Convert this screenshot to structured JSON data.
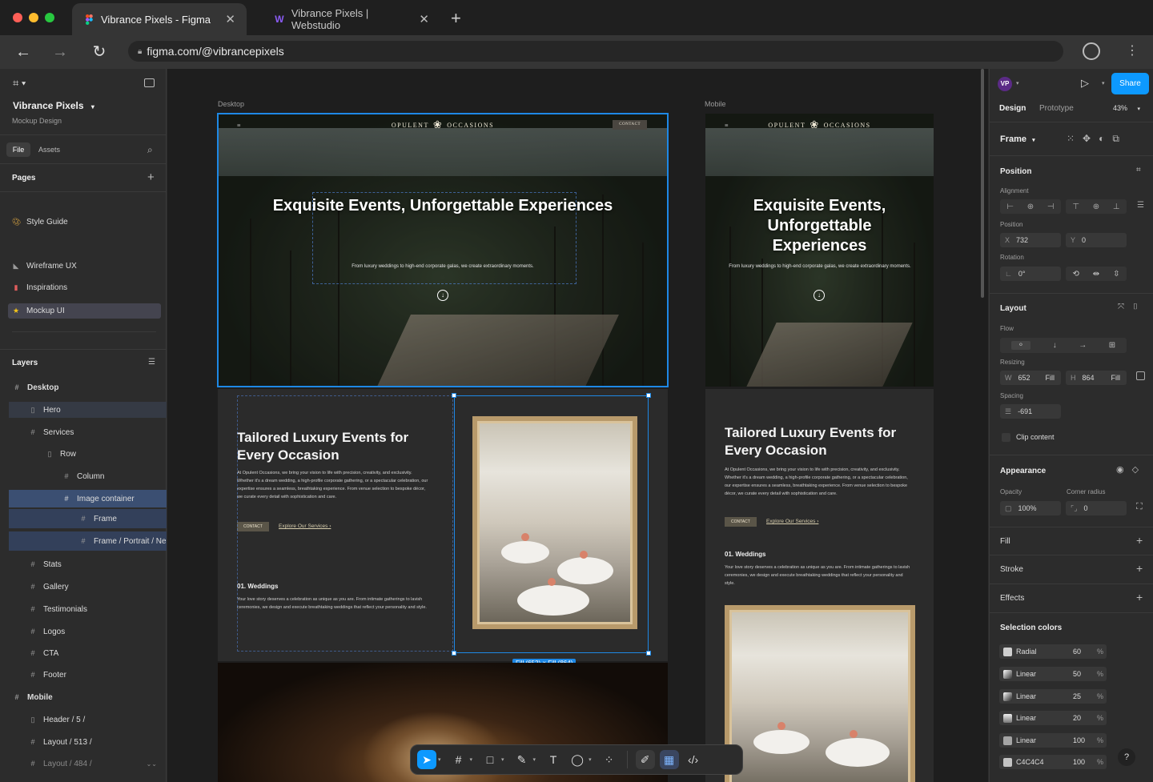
{
  "browser": {
    "tabs": [
      {
        "title": "Vibrance Pixels - Figma",
        "favicon": "figma-icon"
      },
      {
        "title": "Vibrance Pixels | Webstudio",
        "favicon": "webstudio-icon"
      }
    ],
    "url": "figma.com/@vibrancepixels"
  },
  "left_panel": {
    "team": "Vibrance Pixels",
    "project": "Mockup Design",
    "tabs": [
      "File",
      "Assets"
    ],
    "pages_title": "Pages",
    "pages": [
      "Style Guide",
      "Wireframe UX",
      "Inspirations",
      "Mockup UI"
    ],
    "layers_title": "Layers",
    "layers": [
      {
        "name": "Desktop",
        "icon": "frame-icon"
      },
      {
        "name": "Hero",
        "icon": "layout-icon"
      },
      {
        "name": "Services",
        "icon": "frame-icon"
      },
      {
        "name": "Row",
        "icon": "layout-icon"
      },
      {
        "name": "Column",
        "icon": "frame-icon"
      },
      {
        "name": "Image container",
        "icon": "grid-icon"
      },
      {
        "name": "Frame",
        "icon": "grid-icon"
      },
      {
        "name": "Frame / Portrait / Ne",
        "icon": "grid-icon"
      },
      {
        "name": "Stats",
        "icon": "frame-icon"
      },
      {
        "name": "Gallery",
        "icon": "frame-icon"
      },
      {
        "name": "Testimonials",
        "icon": "frame-icon"
      },
      {
        "name": "Logos",
        "icon": "frame-icon"
      },
      {
        "name": "CTA",
        "icon": "frame-icon"
      },
      {
        "name": "Footer",
        "icon": "frame-icon"
      },
      {
        "name": "Mobile",
        "icon": "frame-icon"
      },
      {
        "name": "Header / 5 /",
        "icon": "layout-icon"
      },
      {
        "name": "Layout / 513 /",
        "icon": "frame-icon"
      },
      {
        "name": "Layout / 484 /",
        "icon": "frame-icon"
      }
    ]
  },
  "canvas": {
    "desktop_label": "Desktop",
    "mobile_label": "Mobile",
    "brand_left": "OPULENT",
    "brand_right": "OCCASIONS",
    "contact": "CONTACT",
    "hero_title": "Exquisite Events, Unforgettable Experiences",
    "hero_sub": "From luxury weddings to high-end corporate galas, we create extraordinary moments.",
    "services_title": "Tailored Luxury Events for Every Occasion",
    "services_body": "At Opulent Occasions, we bring your vision to life with precision, creativity, and exclusivity. Whether it's a dream wedding, a high-profile corporate gathering, or a spectacular celebration, our expertise ensures a seamless, breathtaking experience. From venue selection to bespoke décor, we curate every detail with sophistication and care.",
    "explore": "Explore Our Services",
    "weddings_title": "01. Weddings",
    "weddings_body": "Your love story deserves a celebration as unique as you are. From intimate gatherings to lavish ceremonies, we design and execute breathtaking weddings that reflect your personality and style.",
    "size_badge": "Fill (652) × Fill (864)"
  },
  "right_panel": {
    "avatar": "VP",
    "share": "Share",
    "tabs": [
      "Design",
      "Prototype"
    ],
    "zoom": "43%",
    "frame_label": "Frame",
    "position_title": "Position",
    "alignment_label": "Alignment",
    "position_label": "Position",
    "x_label": "X",
    "x": "732",
    "y_label": "Y",
    "y": "0",
    "rotation_label": "Rotation",
    "rotation": "0°",
    "layout_title": "Layout",
    "flow_label": "Flow",
    "resizing_label": "Resizing",
    "w_label": "W",
    "w": "652",
    "w_mode": "Fill",
    "h_label": "H",
    "h": "864",
    "h_mode": "Fill",
    "spacing_label": "Spacing",
    "spacing": "-691",
    "clip": "Clip content",
    "appearance_title": "Appearance",
    "opacity_label": "Opacity",
    "opacity": "100%",
    "radius_label": "Corner radius",
    "radius": "0",
    "fill": "Fill",
    "stroke": "Stroke",
    "effects": "Effects",
    "selection_colors_title": "Selection colors",
    "selection_colors": [
      {
        "name": "Radial",
        "value": "60",
        "unit": "%",
        "color": "#cfcfcf"
      },
      {
        "name": "Linear",
        "value": "50",
        "unit": "%",
        "color": "#9a9a9a"
      },
      {
        "name": "Linear",
        "value": "25",
        "unit": "%",
        "color": "#8c8c8c"
      },
      {
        "name": "Linear",
        "value": "20",
        "unit": "%",
        "color": "#b0b0b0"
      },
      {
        "name": "Linear",
        "value": "100",
        "unit": "%",
        "color": "#a5a5a5"
      },
      {
        "name": "C4C4C4",
        "value": "100",
        "unit": "%",
        "color": "#c4c4c4"
      }
    ],
    "help": "?"
  },
  "colors": {
    "accent": "#0d99ff",
    "selection": "#1e88e5"
  }
}
